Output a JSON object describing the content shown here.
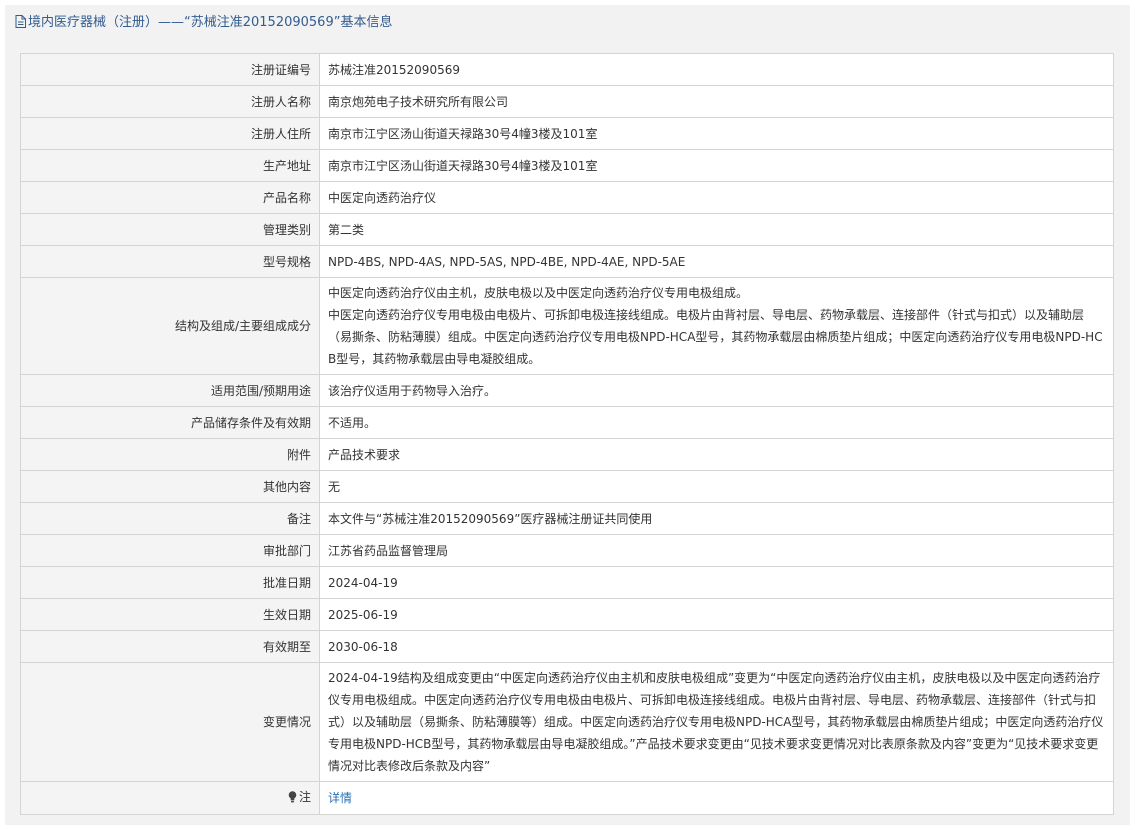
{
  "header": {
    "title": "境内医疗器械（注册）——“苏械注准20152090569”基本信息"
  },
  "rows": [
    {
      "label": "注册证编号",
      "value": "苏械注准20152090569"
    },
    {
      "label": "注册人名称",
      "value": "南京炮苑电子技术研究所有限公司"
    },
    {
      "label": "注册人住所",
      "value": "南京市江宁区汤山街道天禄路30号4幢3楼及101室"
    },
    {
      "label": "生产地址",
      "value": "南京市江宁区汤山街道天禄路30号4幢3楼及101室"
    },
    {
      "label": "产品名称",
      "value": "中医定向透药治疗仪"
    },
    {
      "label": "管理类别",
      "value": "第二类"
    },
    {
      "label": "型号规格",
      "value": "NPD-4BS, NPD-4AS, NPD-5AS, NPD-4BE, NPD-4AE, NPD-5AE"
    },
    {
      "label": "结构及组成/主要组成成分",
      "value": "中医定向透药治疗仪由主机，皮肤电极以及中医定向透药治疗仪专用电极组成。\n中医定向透药治疗仪专用电极由电极片、可拆卸电极连接线组成。电极片由背衬层、导电层、药物承载层、连接部件（针式与扣式）以及辅助层（易撕条、防粘薄膜）组成。中医定向透药治疗仪专用电极NPD-HCA型号，其药物承载层由棉质垫片组成；中医定向透药治疗仪专用电极NPD-HCB型号，其药物承载层由导电凝胶组成。"
    },
    {
      "label": "适用范围/预期用途",
      "value": "该治疗仪适用于药物导入治疗。"
    },
    {
      "label": "产品储存条件及有效期",
      "value": "不适用。"
    },
    {
      "label": "附件",
      "value": "产品技术要求"
    },
    {
      "label": "其他内容",
      "value": "无"
    },
    {
      "label": "备注",
      "value": "本文件与“苏械注准20152090569”医疗器械注册证共同使用"
    },
    {
      "label": "审批部门",
      "value": "江苏省药品监督管理局"
    },
    {
      "label": "批准日期",
      "value": "2024-04-19"
    },
    {
      "label": "生效日期",
      "value": "2025-06-19"
    },
    {
      "label": "有效期至",
      "value": "2030-06-18"
    },
    {
      "label": "变更情况",
      "value": "2024-04-19结构及组成变更由“中医定向透药治疗仪由主机和皮肤电极组成”变更为“中医定向透药治疗仪由主机，皮肤电极以及中医定向透药治疗仪专用电极组成。中医定向透药治疗仪专用电极由电极片、可拆卸电极连接线组成。电极片由背衬层、导电层、药物承载层、连接部件（针式与扣式）以及辅助层（易撕条、防粘薄膜等）组成。中医定向透药治疗仪专用电极NPD-HCA型号，其药物承载层由棉质垫片组成；中医定向透药治疗仪专用电极NPD-HCB型号，其药物承载层由导电凝胶组成。”产品技术要求变更由“见技术要求变更情况对比表原条款及内容”变更为“见技术要求变更情况对比表修改后条款及内容”"
    }
  ],
  "note": {
    "label": "注",
    "icon": "lightbulb-icon",
    "link_text": "详情"
  },
  "colors": {
    "header_text": "#335c8e",
    "link": "#2a6fb8",
    "border": "#d4d4d4",
    "label_bg": "#f4f4f4",
    "panel_bg": "#f2f2f2"
  }
}
